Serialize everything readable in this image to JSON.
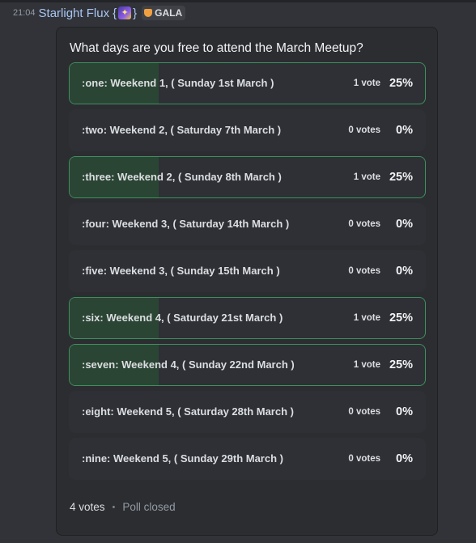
{
  "message": {
    "timestamp": "21:04",
    "username": "Starlight Flux",
    "brace_open": "{",
    "tag_emoji": "✦",
    "brace_close": "}",
    "guild_tag": "GALA"
  },
  "poll": {
    "question": "What days are you free to attend the March Meetup?",
    "answers": [
      {
        "label": ":one: Weekend 1, ( Sunday 1st March )",
        "votes": "1 vote",
        "percent": "25%",
        "fraction": 0.25,
        "voted": true
      },
      {
        "label": ":two: Weekend 2, ( Saturday 7th March )",
        "votes": "0 votes",
        "percent": "0%",
        "fraction": 0,
        "voted": false
      },
      {
        "label": ":three: Weekend 2, ( Sunday 8th March )",
        "votes": "1 vote",
        "percent": "25%",
        "fraction": 0.25,
        "voted": true
      },
      {
        "label": ":four: Weekend 3, ( Saturday 14th March )",
        "votes": "0 votes",
        "percent": "0%",
        "fraction": 0,
        "voted": false
      },
      {
        "label": ":five: Weekend 3, ( Sunday 15th March )",
        "votes": "0 votes",
        "percent": "0%",
        "fraction": 0,
        "voted": false
      },
      {
        "label": ":six: Weekend 4, ( Saturday 21st March )",
        "votes": "1 vote",
        "percent": "25%",
        "fraction": 0.25,
        "voted": true
      },
      {
        "label": ":seven: Weekend 4, ( Sunday 22nd March )",
        "votes": "1 vote",
        "percent": "25%",
        "fraction": 0.25,
        "voted": true
      },
      {
        "label": ":eight: Weekend 5, ( Saturday 28th March )",
        "votes": "0 votes",
        "percent": "0%",
        "fraction": 0,
        "voted": false
      },
      {
        "label": ":nine: Weekend 5, ( Sunday 29th March )",
        "votes": "0 votes",
        "percent": "0%",
        "fraction": 0,
        "voted": false
      }
    ],
    "total_votes": "4 votes",
    "separator": "•",
    "status": "Poll closed"
  },
  "colors": {
    "background": "#313338",
    "poll_card": "#2b2d31",
    "answer_bg": "#2e3035",
    "voted_border": "#3f8f5e",
    "vote_fill": "#2b4535",
    "username": "#a8c6f4"
  },
  "icons": {
    "tag_emoji": "sparkle-wand-icon",
    "guild_tag": "shield-badge-icon"
  }
}
